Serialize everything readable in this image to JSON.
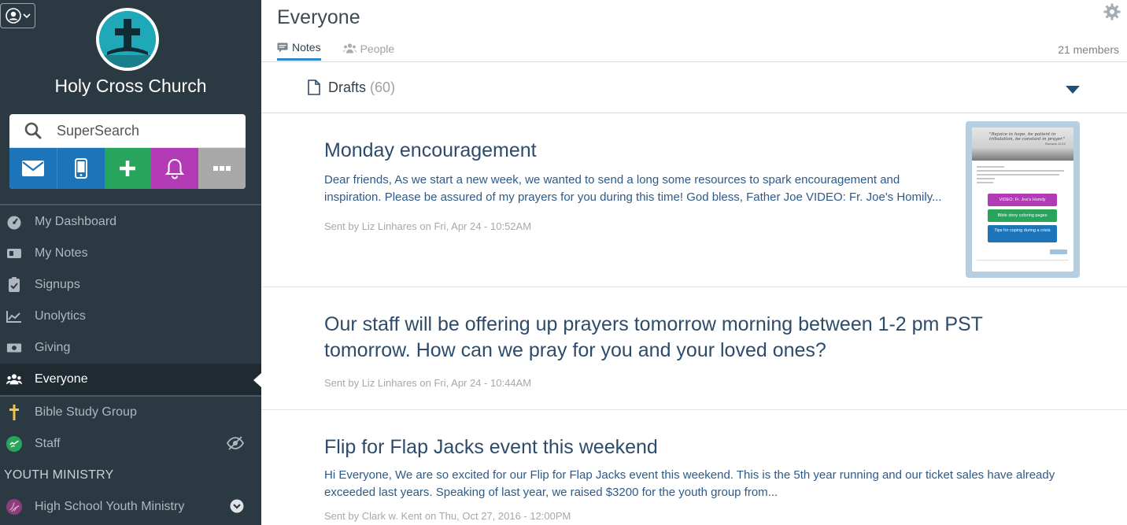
{
  "sidebar": {
    "church_name": "Holy Cross Church",
    "search_placeholder": "SuperSearch",
    "quick_actions": [
      "mail-icon",
      "phone-icon",
      "plus-icon",
      "bell-icon",
      "more-icon"
    ],
    "nav": [
      {
        "label": "My Dashboard",
        "icon": "dashboard-icon"
      },
      {
        "label": "My Notes",
        "icon": "notes-icon"
      },
      {
        "label": "Signups",
        "icon": "signups-icon"
      },
      {
        "label": "Unolytics",
        "icon": "analytics-icon"
      },
      {
        "label": "Giving",
        "icon": "giving-icon"
      },
      {
        "label": "Everyone",
        "icon": "people-icon",
        "active": true
      }
    ],
    "groups": [
      {
        "label": "Bible Study Group",
        "icon": "cross-icon"
      },
      {
        "label": "Staff",
        "icon": "staff-icon",
        "trailing": "hidden-eye-icon"
      }
    ],
    "section_label": "YOUTH MINISTRY",
    "youth": [
      {
        "label": "High School Youth Ministry",
        "icon": "youth-icon",
        "trailing": "chevron-down-icon"
      }
    ]
  },
  "main": {
    "title": "Everyone",
    "tabs": [
      {
        "label": "Notes",
        "active": true
      },
      {
        "label": "People",
        "active": false
      }
    ],
    "members": "21 members",
    "drafts": {
      "label": "Drafts",
      "count": "(60)"
    },
    "notes": [
      {
        "title": "Monday encouragement",
        "body": "Dear friends, As we start a new week, we wanted to send a long some resources to spark encouragement and inspiration. Please be assured of my prayers for you during this time! God bless, Father Joe VIDEO: Fr. Joe's Homily...",
        "meta": "Sent by Liz Linhares on Fri, Apr 24 - 10:52AM",
        "thumbnail": {
          "quote": "\"Rejoice in hope, be patient in tribulation, be constant in prayer.\"",
          "ref": "Romans 12:12",
          "buttons": [
            "VIDEO: Fr. Joe's Homily",
            "Bible story coloring pages",
            "Tips for coping during a crisis"
          ]
        }
      },
      {
        "title": "Our staff will be offering up prayers tomorrow morning between 1-2 pm PST tomorrow. How can we pray for you and your loved ones?",
        "meta": "Sent by Liz Linhares on Fri, Apr 24 - 10:44AM"
      },
      {
        "title": "Flip for Flap Jacks event this weekend",
        "body": "Hi Everyone, We are so excited for our Flip for Flap Jacks event this weekend. This is the 5th year running and our ticket sales have already exceeded last years. Speaking of last year, we raised $3200 for the youth group from...",
        "meta": "Sent by Clark w. Kent on Thu, Oct 27, 2016 - 12:00PM"
      }
    ]
  },
  "colors": {
    "sidebar_bg": "#2b3942",
    "accent_blue": "#1d74b8",
    "accent_green": "#27a55c",
    "accent_purple": "#b23ab5",
    "title_blue": "#2d4b6a"
  }
}
